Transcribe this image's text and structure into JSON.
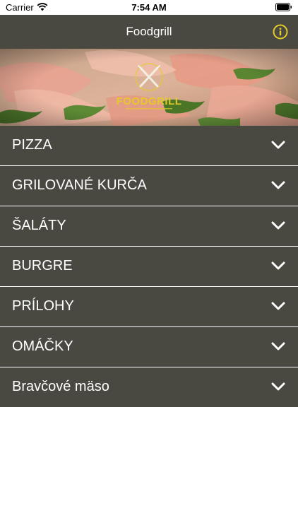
{
  "status_bar": {
    "carrier": "Carrier",
    "time": "7:54 AM"
  },
  "nav": {
    "title": "Foodgrill",
    "info_icon": "info-circle-icon",
    "accent_color": "#e4cc2a",
    "bar_color": "#4a4941"
  },
  "banner": {
    "logo_text": "FOODGRILL"
  },
  "menu": {
    "items": [
      {
        "label": "PIZZA"
      },
      {
        "label": "GRILOVANÉ KURČA"
      },
      {
        "label": "ŠALÁTY"
      },
      {
        "label": "BURGRE"
      },
      {
        "label": "PRÍLOHY"
      },
      {
        "label": "OMÁČKY"
      },
      {
        "label": "Bravčové mäso"
      }
    ],
    "chevron_icon": "chevron-down-icon"
  }
}
